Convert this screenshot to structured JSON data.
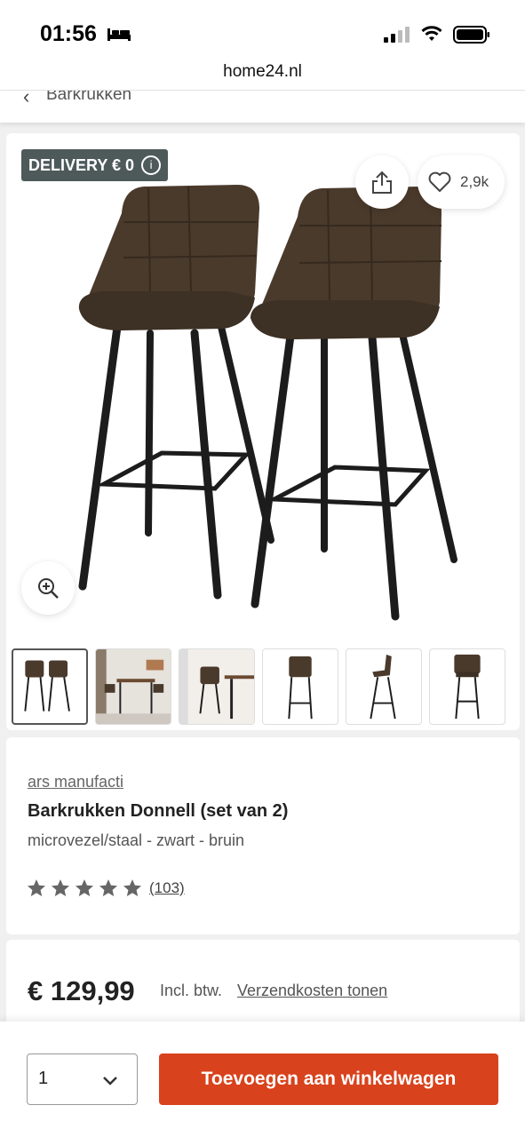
{
  "status_bar": {
    "time": "01:56",
    "icons": [
      "bed-icon",
      "signal-icon",
      "wifi-icon",
      "battery-icon"
    ]
  },
  "browser": {
    "url": "home24.nl"
  },
  "breadcrumb": {
    "back_label": "Barkrukken",
    "icon": "chevron-left-icon"
  },
  "gallery": {
    "badge": "DELIVERY € 0",
    "badge_info_symbol": "i",
    "wishlist_count": "2,9k",
    "icons": [
      "share-icon",
      "heart-icon",
      "zoom-in-icon"
    ],
    "active_thumbnail": 0,
    "thumbnail_count": 6
  },
  "product": {
    "brand": "ars manufacti",
    "title": "Barkrukken Donnell (set van 2)",
    "variant": "microvezel/staal - zwart - bruin",
    "rating_stars": 5,
    "reviews": "(103)"
  },
  "pricing": {
    "price": "€ 129,99",
    "vat": "Incl. btw.",
    "shipping_link": "Verzendkosten tonen"
  },
  "cart": {
    "quantity": "1",
    "add_button": "Toevoegen aan winkelwagen"
  },
  "colors": {
    "accent": "#d8421c",
    "badge": "#4e5a5a",
    "seat": "#4a3a2c"
  }
}
